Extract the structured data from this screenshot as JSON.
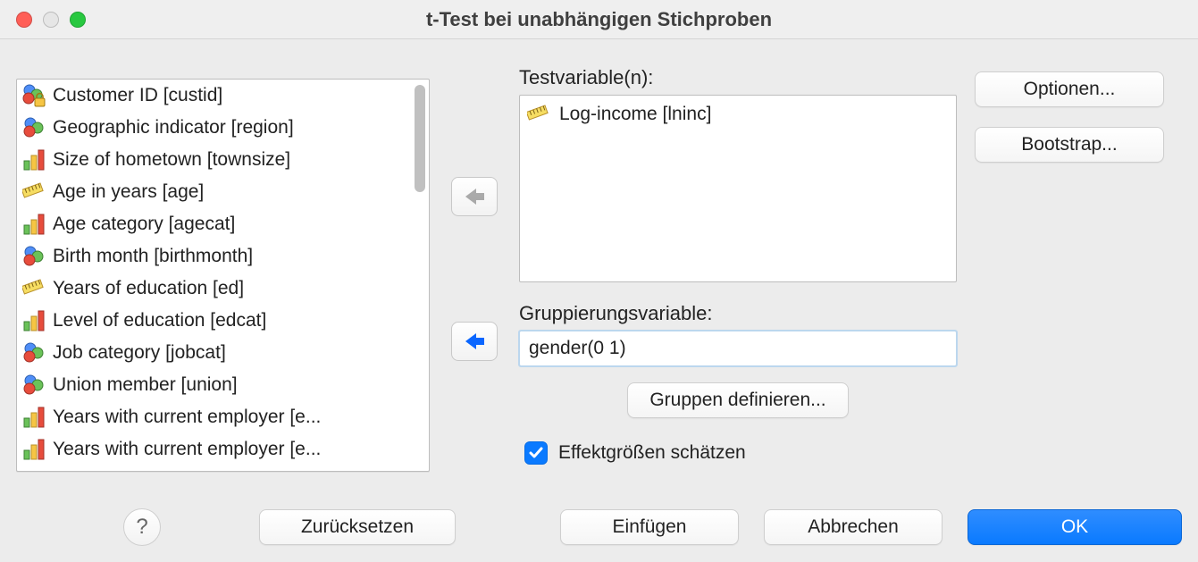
{
  "window": {
    "title": "t-Test bei unabhängigen Stichproben"
  },
  "variable_list": [
    {
      "label": "Customer ID [custid]",
      "icon": "nominal-lock"
    },
    {
      "label": "Geographic indicator [region]",
      "icon": "nominal"
    },
    {
      "label": "Size of hometown [townsize]",
      "icon": "ordinal"
    },
    {
      "label": "Age in years [age]",
      "icon": "scale"
    },
    {
      "label": "Age category [agecat]",
      "icon": "ordinal"
    },
    {
      "label": "Birth month [birthmonth]",
      "icon": "nominal"
    },
    {
      "label": "Years of education [ed]",
      "icon": "scale"
    },
    {
      "label": "Level of education [edcat]",
      "icon": "ordinal"
    },
    {
      "label": "Job category [jobcat]",
      "icon": "nominal"
    },
    {
      "label": "Union member [union]",
      "icon": "nominal"
    },
    {
      "label": "Years with current employer [e...",
      "icon": "ordinal"
    },
    {
      "label": "Years with current employer [e...",
      "icon": "ordinal"
    }
  ],
  "labels": {
    "test_variables": "Testvariable(n):",
    "grouping_variable": "Gruppierungsvariable:"
  },
  "test_variables": [
    {
      "label": "Log-income [lninc]",
      "icon": "scale"
    }
  ],
  "grouping_variable_value": "gender(0 1)",
  "buttons": {
    "define_groups": "Gruppen definieren...",
    "options": "Optionen...",
    "bootstrap": "Bootstrap...",
    "reset": "Zurücksetzen",
    "paste": "Einfügen",
    "cancel": "Abbrechen",
    "ok": "OK"
  },
  "checkboxes": {
    "effect_sizes_label": "Effektgrößen schätzen",
    "effect_sizes_checked": true
  },
  "help_glyph": "?"
}
